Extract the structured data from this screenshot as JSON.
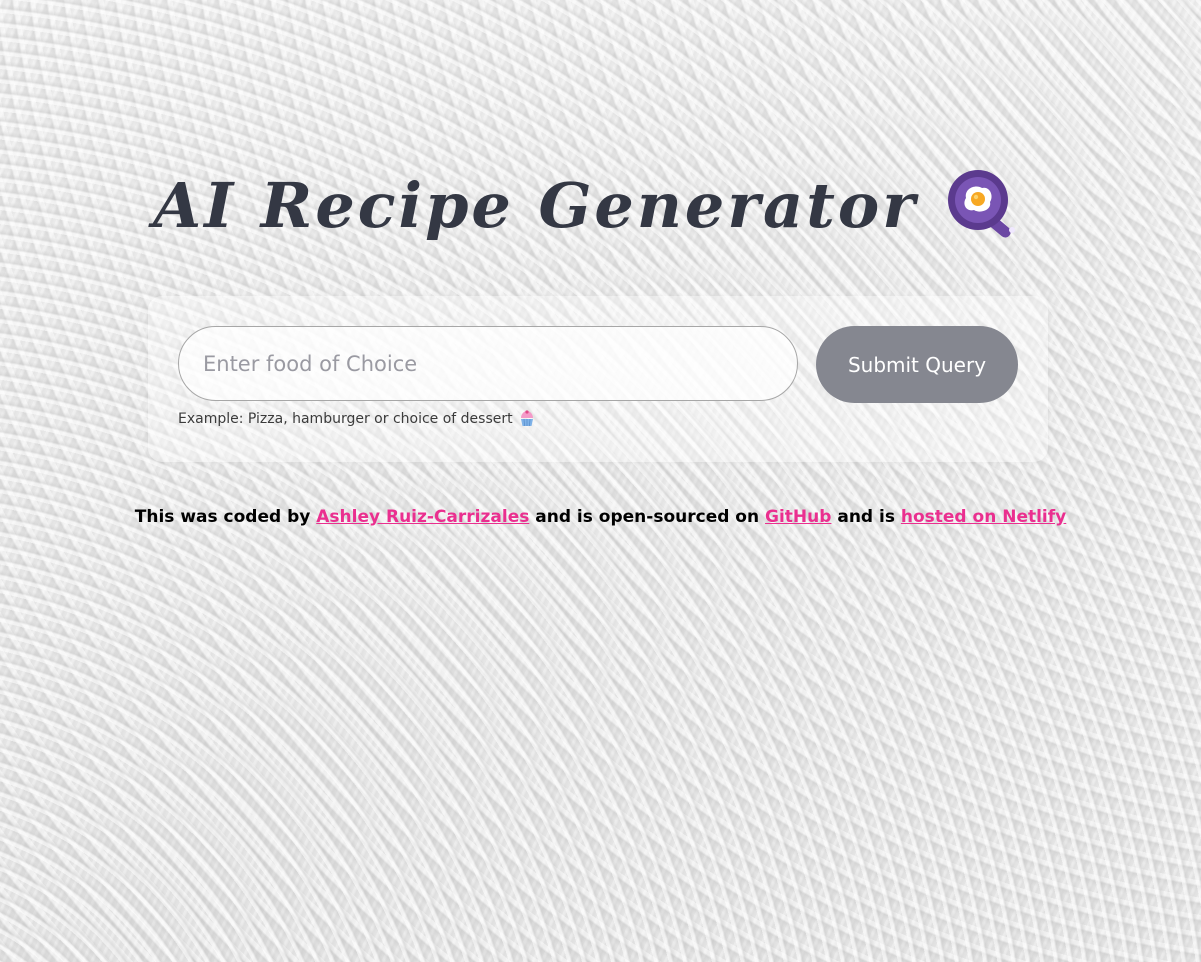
{
  "header": {
    "title": "AI Recipe Generator",
    "icon": "frying-pan-egg-icon"
  },
  "form": {
    "input_placeholder": "Enter food of Choice",
    "input_value": "",
    "submit_label": "Submit Query",
    "hint_text": "Example: Pizza, hamburger or choice of dessert",
    "hint_icon": "cupcake-icon"
  },
  "footer": {
    "prefix": "This was coded by",
    "author_link": "Ashley Ruiz-Carrizales",
    "middle1": "and is open-sourced on",
    "github_link": "GitHub",
    "middle2": "and is",
    "netlify_link": "hosted on Netlify"
  },
  "colors": {
    "title": "#343844",
    "link": "#ea2f8f",
    "button": "#858790",
    "pan": "#5b3a8e"
  }
}
